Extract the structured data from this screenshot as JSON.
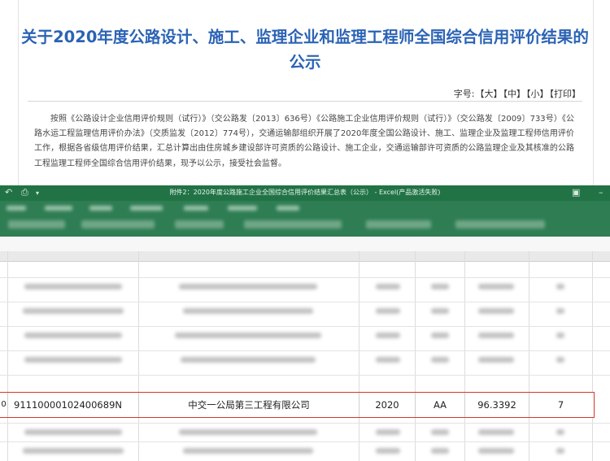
{
  "article": {
    "title": "关于2020年度公路设计、施工、监理企业和监理工程师全国综合信用评价结果的公示",
    "font_size_label": "字号:",
    "font_sizes": [
      "【大】",
      "【中】",
      "【小】"
    ],
    "print": "【打印】",
    "body": "按照《公路设计企业信用评价规则（试行）》（交公路发〔2013〕636号）《公路施工企业信用评价规则（试行）》（交公路发〔2009〕733号）《公路水运工程监理信用评价办法》（交质监发〔2012〕774号），交通运输部组织开展了2020年度全国公路设计、施工、监理企业及监理工程师信用评价工作，根据各省级信用评价结果，汇总计算出由住房城乡建设部许可资质的公路设计、施工企业，交通运输部许可资质的公路监理企业及其核准的公路工程监理工程师全国综合信用评价结果，现予以公示，接受社会监督。"
  },
  "excel": {
    "window_title": "附件2：2020年度公路施工企业全国综合信用评价结果汇总表（公示） - Excel(产品激活失败)",
    "accent_color": "#217346",
    "highlight_color": "#d8342c",
    "highlight_row": {
      "row_num": "0",
      "credit_code": "91110000102400689N",
      "company": "中交一公局第三工程有限公司",
      "year": "2020",
      "grade": "AA",
      "score": "96.3392",
      "rank": "7"
    }
  }
}
